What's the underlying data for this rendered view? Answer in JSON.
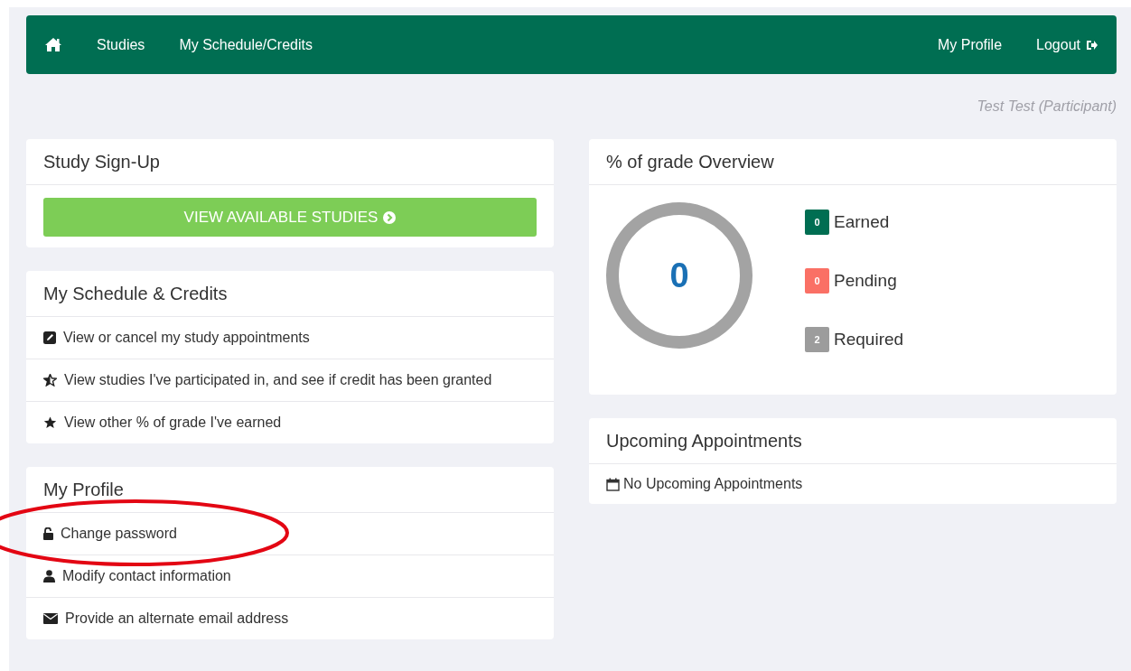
{
  "nav": {
    "items": [
      {
        "kind": "home"
      },
      {
        "kind": "link",
        "label": "Studies"
      },
      {
        "kind": "link",
        "label": "My Schedule/Credits"
      }
    ],
    "right_items": [
      {
        "kind": "link",
        "label": "My Profile"
      },
      {
        "kind": "logout",
        "label": "Logout"
      }
    ]
  },
  "user": "Test Test (Participant)",
  "study_signup": {
    "title": "Study Sign-Up",
    "button": "VIEW AVAILABLE STUDIES"
  },
  "schedule_credits": {
    "title": "My Schedule & Credits",
    "items": [
      {
        "label": "View or cancel my study appointments"
      },
      {
        "label": "View studies I've participated in, and see if credit has been granted"
      },
      {
        "label": "View other % of grade I've earned"
      }
    ]
  },
  "profile": {
    "title": "My Profile",
    "items": [
      {
        "label": "Change password"
      },
      {
        "label": "Modify contact information"
      },
      {
        "label": "Provide an alternate email address"
      }
    ]
  },
  "grade_overview": {
    "title": "% of grade Overview",
    "total": "0",
    "legend": [
      {
        "count": "0",
        "label": "Earned",
        "color": "#006e52"
      },
      {
        "count": "0",
        "label": "Pending",
        "color": "#fa7065"
      },
      {
        "count": "2",
        "label": "Required",
        "color": "#9c9c9c"
      }
    ]
  },
  "appointments": {
    "title": "Upcoming Appointments",
    "message": "No Upcoming Appointments"
  },
  "annotations": [
    {
      "kind": "ellipse"
    }
  ]
}
